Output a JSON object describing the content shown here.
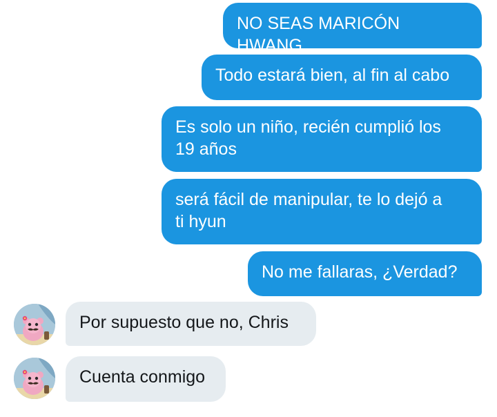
{
  "conversation": {
    "sent_messages": [
      "NO SEAS MARICÓN HWANG",
      "Todo estará bien, al fin al cabo",
      "Es solo un niño, recién cumplió los\n19 años",
      "será fácil de manipular, te lo dejó a\nti hyun",
      "No me fallaras, ¿Verdad?"
    ],
    "received_messages": [
      "Por supuesto que no, Chris",
      "Cuenta conmigo"
    ]
  },
  "colors": {
    "sent_bubble": "#1b95e0",
    "received_bubble": "#e6ecf0",
    "sent_text": "#ffffff",
    "received_text": "#14171a"
  },
  "avatar": {
    "icon": "pink-bear-with-mustache-avatar"
  }
}
